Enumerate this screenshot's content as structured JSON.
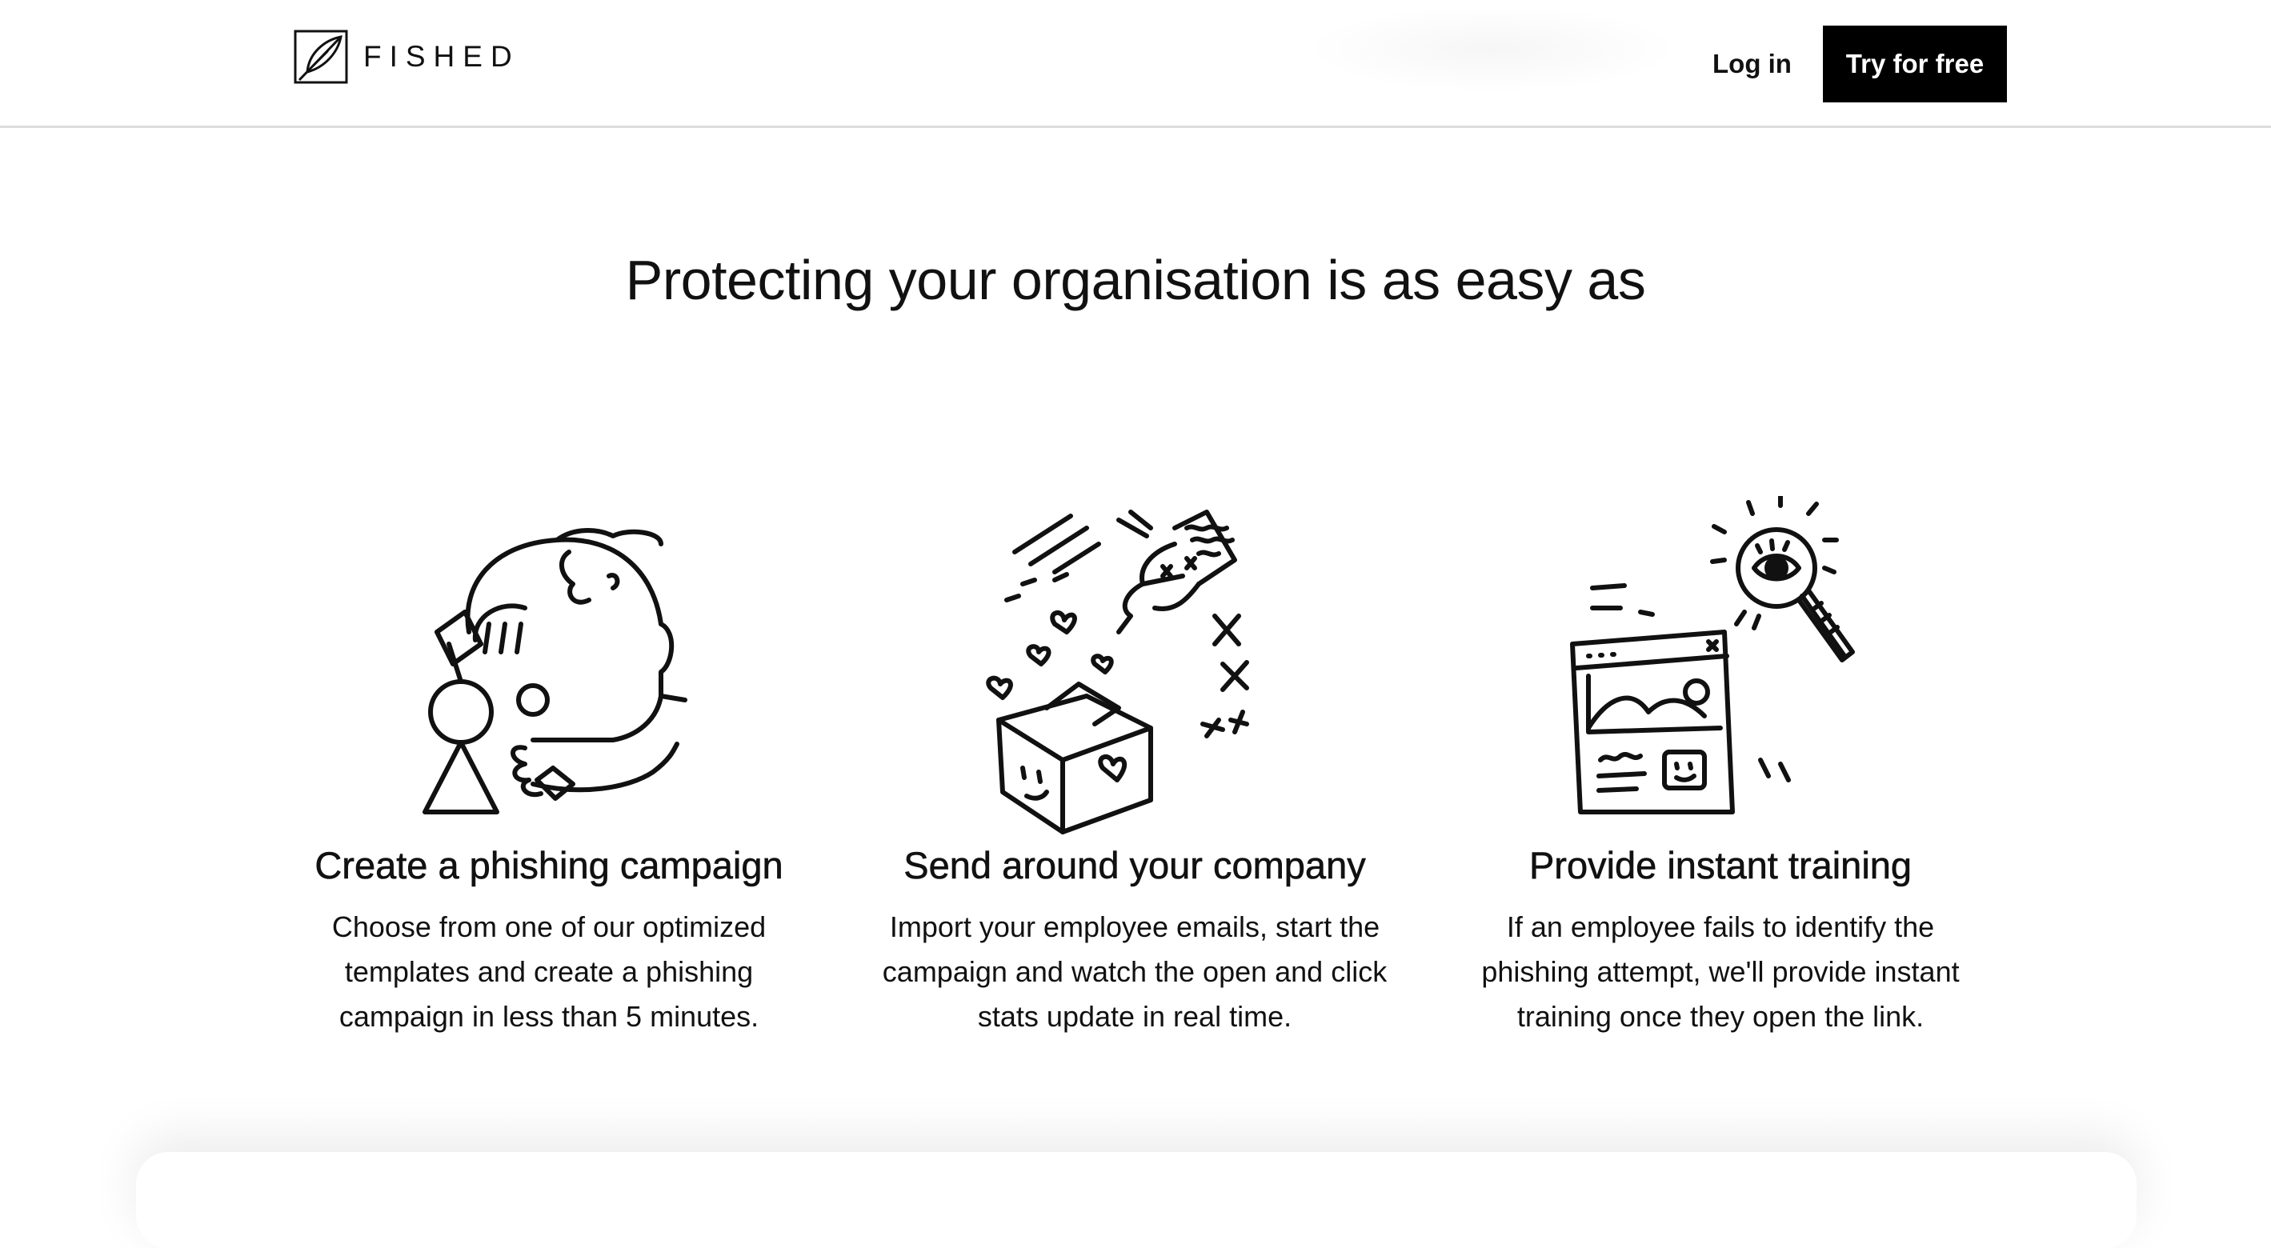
{
  "nav": {
    "logo_text": "FISHED",
    "login_label": "Log in",
    "cta_label": "Try for free"
  },
  "hero": {
    "heading": "Protecting your organisation is as easy as"
  },
  "steps": [
    {
      "icon": "phishing-campaign-illustration",
      "title": "Create a phishing campaign",
      "description": "Choose from one of our optimized templates and create a phishing campaign in less than 5 minutes."
    },
    {
      "icon": "send-company-illustration",
      "title": "Send around your company",
      "description": "Import your employee emails, start the campaign and watch the open and click stats update in real time."
    },
    {
      "icon": "instant-training-illustration",
      "title": "Provide instant training",
      "description": "If an employee fails to identify the phishing attempt, we'll provide instant training once they open the link."
    }
  ]
}
